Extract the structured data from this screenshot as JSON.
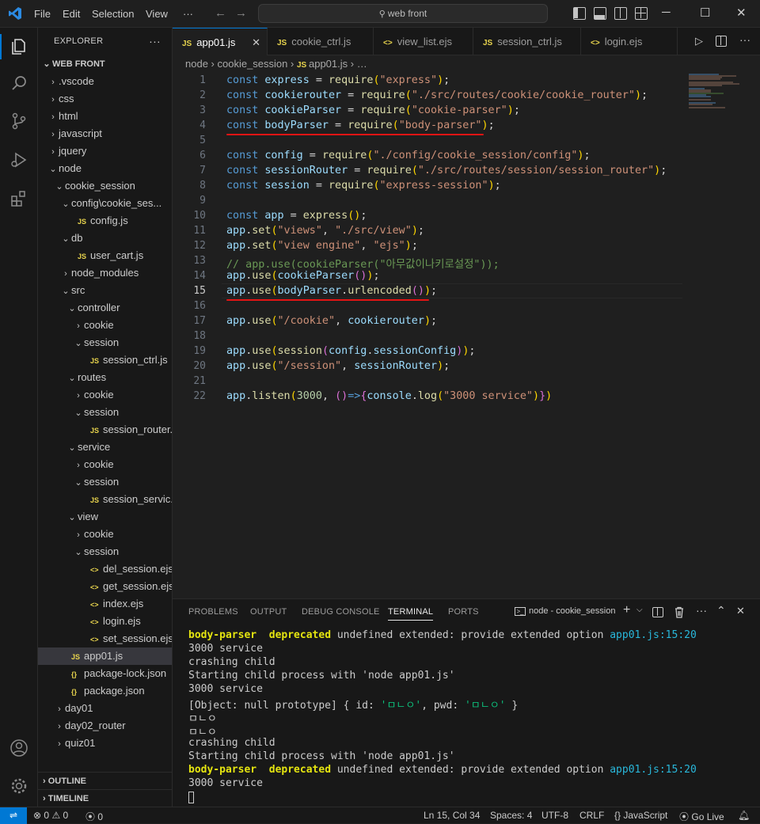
{
  "titlebar": {
    "menu": [
      "File",
      "Edit",
      "Selection",
      "View",
      "···"
    ],
    "search": "web front"
  },
  "explorer": {
    "header": "EXPLORER",
    "root": "WEB FRONT",
    "items": [
      {
        "label": ".vscode",
        "depth": 1,
        "type": "folder",
        "open": false
      },
      {
        "label": "css",
        "depth": 1,
        "type": "folder",
        "open": false
      },
      {
        "label": "html",
        "depth": 1,
        "type": "folder",
        "open": false
      },
      {
        "label": "javascript",
        "depth": 1,
        "type": "folder",
        "open": false
      },
      {
        "label": "jquery",
        "depth": 1,
        "type": "folder",
        "open": false
      },
      {
        "label": "node",
        "depth": 1,
        "type": "folder",
        "open": true
      },
      {
        "label": "cookie_session",
        "depth": 2,
        "type": "folder",
        "open": true
      },
      {
        "label": "config\\cookie_ses...",
        "depth": 3,
        "type": "folder",
        "open": true
      },
      {
        "label": "config.js",
        "depth": 4,
        "type": "js"
      },
      {
        "label": "db",
        "depth": 3,
        "type": "folder",
        "open": true
      },
      {
        "label": "user_cart.js",
        "depth": 4,
        "type": "js"
      },
      {
        "label": "node_modules",
        "depth": 3,
        "type": "folder",
        "open": false
      },
      {
        "label": "src",
        "depth": 3,
        "type": "folder",
        "open": true
      },
      {
        "label": "controller",
        "depth": 4,
        "type": "folder",
        "open": true
      },
      {
        "label": "cookie",
        "depth": 5,
        "type": "folder",
        "open": false
      },
      {
        "label": "session",
        "depth": 5,
        "type": "folder",
        "open": true
      },
      {
        "label": "session_ctrl.js",
        "depth": 6,
        "type": "js"
      },
      {
        "label": "routes",
        "depth": 4,
        "type": "folder",
        "open": true
      },
      {
        "label": "cookie",
        "depth": 5,
        "type": "folder",
        "open": false
      },
      {
        "label": "session",
        "depth": 5,
        "type": "folder",
        "open": true
      },
      {
        "label": "session_router.js",
        "depth": 6,
        "type": "js"
      },
      {
        "label": "service",
        "depth": 4,
        "type": "folder",
        "open": true
      },
      {
        "label": "cookie",
        "depth": 5,
        "type": "folder",
        "open": false
      },
      {
        "label": "session",
        "depth": 5,
        "type": "folder",
        "open": true
      },
      {
        "label": "session_servic...",
        "depth": 6,
        "type": "js"
      },
      {
        "label": "view",
        "depth": 4,
        "type": "folder",
        "open": true
      },
      {
        "label": "cookie",
        "depth": 5,
        "type": "folder",
        "open": false
      },
      {
        "label": "session",
        "depth": 5,
        "type": "folder",
        "open": true
      },
      {
        "label": "del_session.ejs",
        "depth": 6,
        "type": "ejs"
      },
      {
        "label": "get_session.ejs",
        "depth": 6,
        "type": "ejs"
      },
      {
        "label": "index.ejs",
        "depth": 6,
        "type": "ejs"
      },
      {
        "label": "login.ejs",
        "depth": 6,
        "type": "ejs"
      },
      {
        "label": "set_session.ejs",
        "depth": 6,
        "type": "ejs"
      },
      {
        "label": "app01.js",
        "depth": 3,
        "type": "js",
        "selected": true
      },
      {
        "label": "package-lock.json",
        "depth": 3,
        "type": "json"
      },
      {
        "label": "package.json",
        "depth": 3,
        "type": "json"
      },
      {
        "label": "day01",
        "depth": 2,
        "type": "folder",
        "open": false
      },
      {
        "label": "day02_router",
        "depth": 2,
        "type": "folder",
        "open": false
      },
      {
        "label": "quiz01",
        "depth": 2,
        "type": "folder",
        "open": false
      }
    ],
    "outline": "OUTLINE",
    "timeline": "TIMELINE"
  },
  "tabs": [
    {
      "label": "app01.js",
      "icon": "JS",
      "active": true
    },
    {
      "label": "cookie_ctrl.js",
      "icon": "JS"
    },
    {
      "label": "view_list.ejs",
      "icon": "<>"
    },
    {
      "label": "session_ctrl.js",
      "icon": "JS"
    },
    {
      "label": "login.ejs",
      "icon": "<>"
    }
  ],
  "breadcrumb": [
    "node",
    "cookie_session",
    "app01.js",
    "…"
  ],
  "code": [
    [
      [
        "kw",
        "const "
      ],
      [
        "var",
        "express"
      ],
      [
        "pun",
        " = "
      ],
      [
        "fn",
        "require"
      ],
      [
        "br",
        "("
      ],
      [
        "str",
        "\"express\""
      ],
      [
        "br",
        ")"
      ],
      [
        "pun",
        ";"
      ]
    ],
    [
      [
        "kw",
        "const "
      ],
      [
        "var",
        "cookierouter"
      ],
      [
        "pun",
        " = "
      ],
      [
        "fn",
        "require"
      ],
      [
        "br",
        "("
      ],
      [
        "str",
        "\"./src/routes/cookie/cookie_router\""
      ],
      [
        "br",
        ")"
      ],
      [
        "pun",
        ";"
      ]
    ],
    [
      [
        "kw",
        "const "
      ],
      [
        "var",
        "cookieParser"
      ],
      [
        "pun",
        " = "
      ],
      [
        "fn",
        "require"
      ],
      [
        "br",
        "("
      ],
      [
        "str",
        "\"cookie-parser\""
      ],
      [
        "br",
        ")"
      ],
      [
        "pun",
        ";"
      ]
    ],
    [
      [
        "kw",
        "const "
      ],
      [
        "var",
        "bodyParser"
      ],
      [
        "pun",
        " = "
      ],
      [
        "fn",
        "require"
      ],
      [
        "br",
        "("
      ],
      [
        "str",
        "\"body-parser\""
      ],
      [
        "br",
        ")"
      ],
      [
        "pun",
        ";"
      ]
    ],
    [],
    [
      [
        "kw",
        "const "
      ],
      [
        "var",
        "config"
      ],
      [
        "pun",
        " = "
      ],
      [
        "fn",
        "require"
      ],
      [
        "br",
        "("
      ],
      [
        "str",
        "\"./config/cookie_session/config\""
      ],
      [
        "br",
        ")"
      ],
      [
        "pun",
        ";"
      ]
    ],
    [
      [
        "kw",
        "const "
      ],
      [
        "var",
        "sessionRouter"
      ],
      [
        "pun",
        " = "
      ],
      [
        "fn",
        "require"
      ],
      [
        "br",
        "("
      ],
      [
        "str",
        "\"./src/routes/session/session_router\""
      ],
      [
        "br",
        ")"
      ],
      [
        "pun",
        ";"
      ]
    ],
    [
      [
        "kw",
        "const "
      ],
      [
        "var",
        "session"
      ],
      [
        "pun",
        " = "
      ],
      [
        "fn",
        "require"
      ],
      [
        "br",
        "("
      ],
      [
        "str",
        "\"express-session\""
      ],
      [
        "br",
        ")"
      ],
      [
        "pun",
        ";"
      ]
    ],
    [],
    [
      [
        "kw",
        "const "
      ],
      [
        "var",
        "app"
      ],
      [
        "pun",
        " = "
      ],
      [
        "fn",
        "express"
      ],
      [
        "br",
        "()"
      ],
      [
        "pun",
        ";"
      ]
    ],
    [
      [
        "var",
        "app"
      ],
      [
        "pun",
        "."
      ],
      [
        "fn",
        "set"
      ],
      [
        "br",
        "("
      ],
      [
        "str",
        "\"views\""
      ],
      [
        "pun",
        ", "
      ],
      [
        "str",
        "\"./src/view\""
      ],
      [
        "br",
        ")"
      ],
      [
        "pun",
        ";"
      ]
    ],
    [
      [
        "var",
        "app"
      ],
      [
        "pun",
        "."
      ],
      [
        "fn",
        "set"
      ],
      [
        "br",
        "("
      ],
      [
        "str",
        "\"view engine\""
      ],
      [
        "pun",
        ", "
      ],
      [
        "str",
        "\"ejs\""
      ],
      [
        "br",
        ")"
      ],
      [
        "pun",
        ";"
      ]
    ],
    [
      [
        "cmt",
        "// app.use(cookieParser(\"아무값이나키로설정\"));"
      ]
    ],
    [
      [
        "var",
        "app"
      ],
      [
        "pun",
        "."
      ],
      [
        "fn",
        "use"
      ],
      [
        "br",
        "("
      ],
      [
        "var",
        "cookieParser"
      ],
      [
        "br2",
        "()"
      ],
      [
        "br",
        ")"
      ],
      [
        "pun",
        ";"
      ]
    ],
    [
      [
        "var",
        "app"
      ],
      [
        "pun",
        "."
      ],
      [
        "fn",
        "use"
      ],
      [
        "br",
        "("
      ],
      [
        "var",
        "bodyParser"
      ],
      [
        "pun",
        "."
      ],
      [
        "fn",
        "urlencoded"
      ],
      [
        "br2",
        "()"
      ],
      [
        "br",
        ")"
      ],
      [
        "pun",
        ";"
      ]
    ],
    [],
    [
      [
        "var",
        "app"
      ],
      [
        "pun",
        "."
      ],
      [
        "fn",
        "use"
      ],
      [
        "br",
        "("
      ],
      [
        "str",
        "\"/cookie\""
      ],
      [
        "pun",
        ", "
      ],
      [
        "var",
        "cookierouter"
      ],
      [
        "br",
        ")"
      ],
      [
        "pun",
        ";"
      ]
    ],
    [],
    [
      [
        "var",
        "app"
      ],
      [
        "pun",
        "."
      ],
      [
        "fn",
        "use"
      ],
      [
        "br",
        "("
      ],
      [
        "fn",
        "session"
      ],
      [
        "br2",
        "("
      ],
      [
        "var",
        "config"
      ],
      [
        "pun",
        "."
      ],
      [
        "var",
        "sessionConfig"
      ],
      [
        "br2",
        ")"
      ],
      [
        "br",
        ")"
      ],
      [
        "pun",
        ";"
      ]
    ],
    [
      [
        "var",
        "app"
      ],
      [
        "pun",
        "."
      ],
      [
        "fn",
        "use"
      ],
      [
        "br",
        "("
      ],
      [
        "str",
        "\"/session\""
      ],
      [
        "pun",
        ", "
      ],
      [
        "var",
        "sessionRouter"
      ],
      [
        "br",
        ")"
      ],
      [
        "pun",
        ";"
      ]
    ],
    [],
    [
      [
        "var",
        "app"
      ],
      [
        "pun",
        "."
      ],
      [
        "fn",
        "listen"
      ],
      [
        "br",
        "("
      ],
      [
        "num",
        "3000"
      ],
      [
        "pun",
        ", "
      ],
      [
        "br2",
        "()"
      ],
      [
        "kw",
        "=>"
      ],
      [
        "br2",
        "{"
      ],
      [
        "var",
        "console"
      ],
      [
        "pun",
        "."
      ],
      [
        "fn",
        "log"
      ],
      [
        "br",
        "("
      ],
      [
        "str",
        "\"3000 service\""
      ],
      [
        "br",
        ")"
      ],
      [
        "br2",
        "}"
      ],
      [
        "br",
        ")"
      ]
    ]
  ],
  "current_line": 15,
  "panel": {
    "tabs": [
      "PROBLEMS",
      "OUTPUT",
      "DEBUG CONSOLE",
      "TERMINAL",
      "PORTS"
    ],
    "active_tab": "TERMINAL",
    "terminal_name": "node - cookie_session",
    "lines": [
      [
        [
          "t-yellow",
          "body-parser"
        ],
        [
          "",
          "  "
        ],
        [
          "t-yellow",
          "deprecated"
        ],
        [
          "",
          " undefined extended: provide extended option "
        ],
        [
          "t-cyan",
          "app01.js:15:20"
        ]
      ],
      [
        [
          "",
          "3000 service"
        ]
      ],
      [
        [
          "",
          "crashing child"
        ]
      ],
      [
        [
          "",
          "Starting child process with 'node app01.js'"
        ]
      ],
      [
        [
          "",
          "3000 service"
        ]
      ],
      [
        [
          "",
          "[Object: null prototype] { id: "
        ],
        [
          "t-green",
          "'ㅁㄴㅇ'"
        ],
        [
          "",
          ", pwd: "
        ],
        [
          "t-green",
          "'ㅁㄴㅇ'"
        ],
        [
          "",
          " }"
        ]
      ],
      [
        [
          "",
          "ㅁㄴㅇ"
        ]
      ],
      [
        [
          "",
          "ㅁㄴㅇ"
        ]
      ],
      [
        [
          "",
          "crashing child"
        ]
      ],
      [
        [
          "",
          "Starting child process with 'node app01.js'"
        ]
      ],
      [
        [
          "t-yellow",
          "body-parser"
        ],
        [
          "",
          "  "
        ],
        [
          "t-yellow",
          "deprecated"
        ],
        [
          "",
          " undefined extended: provide extended option "
        ],
        [
          "t-cyan",
          "app01.js:15:20"
        ]
      ],
      [
        [
          "",
          "3000 service"
        ]
      ]
    ]
  },
  "statusbar": {
    "errors": "0",
    "warnings": "0",
    "ports": "0",
    "position": "Ln 15, Col 34",
    "spaces": "Spaces: 4",
    "encoding": "UTF-8",
    "eol": "CRLF",
    "language": "JavaScript",
    "golive": "Go Live"
  },
  "colors": {
    "accent": "#0078d4",
    "underline": "#e51414"
  }
}
